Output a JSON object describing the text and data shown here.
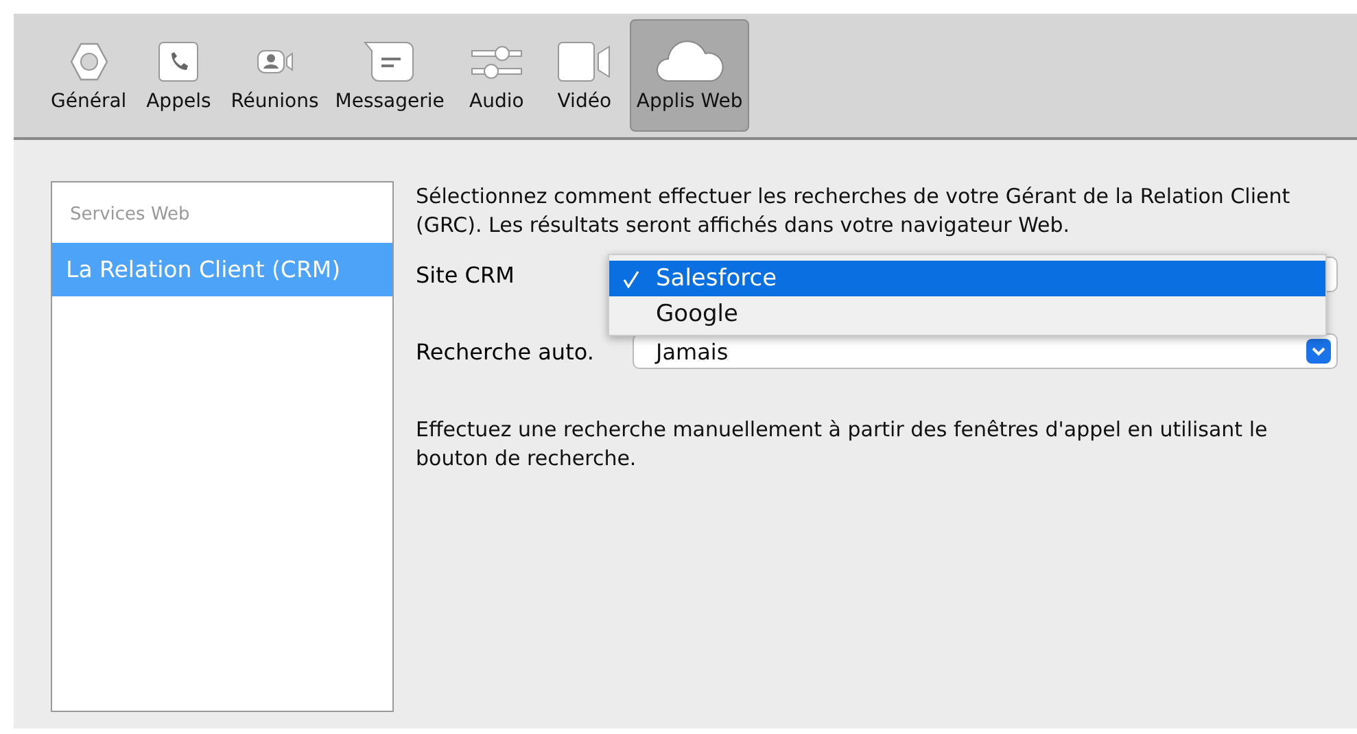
{
  "toolbar": {
    "tabs": [
      {
        "label": "Général",
        "kind": "gear",
        "selected": false
      },
      {
        "label": "Appels",
        "kind": "phone",
        "selected": false
      },
      {
        "label": "Réunions",
        "kind": "camera-person",
        "selected": false
      },
      {
        "label": "Messagerie",
        "kind": "chat",
        "selected": false
      },
      {
        "label": "Audio",
        "kind": "sliders",
        "selected": false
      },
      {
        "label": "Vidéo",
        "kind": "video",
        "selected": false
      },
      {
        "label": "Applis Web",
        "kind": "cloud",
        "selected": true
      }
    ]
  },
  "sidebar": {
    "header": "Services Web",
    "items": [
      {
        "label": "La Relation Client (CRM)",
        "selected": true
      }
    ]
  },
  "content": {
    "intro": "Sélectionnez comment effectuer les recherches de votre Gérant de la Relation Client (GRC). Les résultats seront affichés dans votre navigateur Web.",
    "crm_site": {
      "label": "Site CRM",
      "menu": [
        {
          "label": "Salesforce",
          "selected": true
        },
        {
          "label": "Google",
          "selected": false
        }
      ]
    },
    "auto_search": {
      "label": "Recherche auto.",
      "value": "Jamais"
    },
    "note": "Effectuez une recherche manuellement à partir des fenêtres d'appel en utilisant le bouton de recherche."
  }
}
